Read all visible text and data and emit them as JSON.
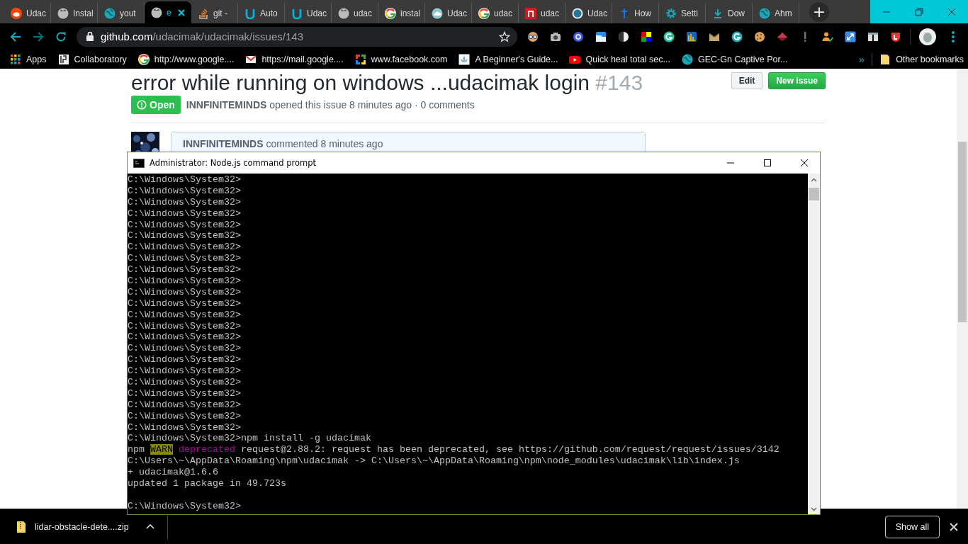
{
  "browser": {
    "tabs": [
      {
        "title": "Udac",
        "selected": false
      },
      {
        "title": "Instal",
        "selected": false
      },
      {
        "title": "yout",
        "selected": false
      },
      {
        "title": "e",
        "selected": true
      },
      {
        "title": "git - ",
        "selected": false
      },
      {
        "title": "Auto",
        "selected": false
      },
      {
        "title": "Udac",
        "selected": false
      },
      {
        "title": "udac",
        "selected": false
      },
      {
        "title": "instal",
        "selected": false
      },
      {
        "title": "Udac",
        "selected": false
      },
      {
        "title": "udac",
        "selected": false
      },
      {
        "title": "udac",
        "selected": false
      },
      {
        "title": "Udac",
        "selected": false
      },
      {
        "title": "How",
        "selected": false
      },
      {
        "title": "Setti",
        "selected": false
      },
      {
        "title": "Dow",
        "selected": false
      },
      {
        "title": "Ahm",
        "selected": false
      }
    ],
    "new_tab": "+",
    "url": {
      "host": "github.com",
      "path": "/udacimak/udacimak/issues/143"
    },
    "bookmarks": [
      {
        "label": "Apps"
      },
      {
        "label": "Collaboratory"
      },
      {
        "label": "http://www.google...."
      },
      {
        "label": "https://mail.google...."
      },
      {
        "label": "www.facebook.com"
      },
      {
        "label": "A Beginner's Guide..."
      },
      {
        "label": "Quick heal total sec..."
      },
      {
        "label": "GEC-Gn Captive Por..."
      }
    ],
    "bookmarks_more": "»",
    "other_bookmarks": "Other bookmarks"
  },
  "page": {
    "title": "error while running on windows ...udacimak login",
    "number": "#143",
    "buttons": [
      {
        "label": "Edit",
        "kind": "secondary"
      },
      {
        "label": "New issue",
        "kind": "primary"
      }
    ],
    "state": "Open",
    "author": "INNFINITEMINDS",
    "meta": "opened this issue 8 minutes ago · 0 comments",
    "comment": {
      "author": "INNFINITEMINDS",
      "meta": "commented 8 minutes ago"
    }
  },
  "terminal": {
    "title": "Administrator: Node.js command prompt",
    "lines": [
      {
        "kind": "text",
        "text": "C:\\Windows\\System32>"
      },
      {
        "kind": "text",
        "text": "C:\\Windows\\System32>"
      },
      {
        "kind": "text",
        "text": "C:\\Windows\\System32>"
      },
      {
        "kind": "text",
        "text": "C:\\Windows\\System32>"
      },
      {
        "kind": "text",
        "text": "C:\\Windows\\System32>"
      },
      {
        "kind": "text",
        "text": "C:\\Windows\\System32>"
      },
      {
        "kind": "text",
        "text": "C:\\Windows\\System32>"
      },
      {
        "kind": "text",
        "text": "C:\\Windows\\System32>"
      },
      {
        "kind": "text",
        "text": "C:\\Windows\\System32>"
      },
      {
        "kind": "text",
        "text": "C:\\Windows\\System32>"
      },
      {
        "kind": "text",
        "text": "C:\\Windows\\System32>"
      },
      {
        "kind": "text",
        "text": "C:\\Windows\\System32>"
      },
      {
        "kind": "text",
        "text": "C:\\Windows\\System32>"
      },
      {
        "kind": "text",
        "text": "C:\\Windows\\System32>"
      },
      {
        "kind": "text",
        "text": "C:\\Windows\\System32>"
      },
      {
        "kind": "text",
        "text": "C:\\Windows\\System32>"
      },
      {
        "kind": "text",
        "text": "C:\\Windows\\System32>"
      },
      {
        "kind": "text",
        "text": "C:\\Windows\\System32>"
      },
      {
        "kind": "text",
        "text": "C:\\Windows\\System32>"
      },
      {
        "kind": "text",
        "text": "C:\\Windows\\System32>"
      },
      {
        "kind": "text",
        "text": "C:\\Windows\\System32>"
      },
      {
        "kind": "text",
        "text": "C:\\Windows\\System32>"
      },
      {
        "kind": "text",
        "text": "C:\\Windows\\System32>"
      },
      {
        "kind": "text",
        "text": "C:\\Windows\\System32>npm install -g udacimak"
      },
      {
        "kind": "segments",
        "segments": [
          {
            "kind": "plain",
            "text": "npm "
          },
          {
            "kind": "warn",
            "text": "WARN"
          },
          {
            "kind": "deprecated",
            "text": " deprecated"
          },
          {
            "kind": "plain",
            "text": " request@2.88.2: request has been deprecated, see https://github.com/request/request/issues/3142"
          }
        ]
      },
      {
        "kind": "text",
        "text": "C:\\Users\\~\\AppData\\Roaming\\npm\\udacimak -> C:\\Users\\~\\AppData\\Roaming\\npm\\node_modules\\udacimak\\lib\\index.js"
      },
      {
        "kind": "text",
        "text": "+ udacimak@1.6.6"
      },
      {
        "kind": "text",
        "text": "updated 1 package in 49.723s"
      },
      {
        "kind": "blank"
      },
      {
        "kind": "text",
        "text": "C:\\Windows\\System32>"
      }
    ]
  },
  "downloads": {
    "file": "lidar-obstacle-dete....zip",
    "show_all": "Show all"
  }
}
